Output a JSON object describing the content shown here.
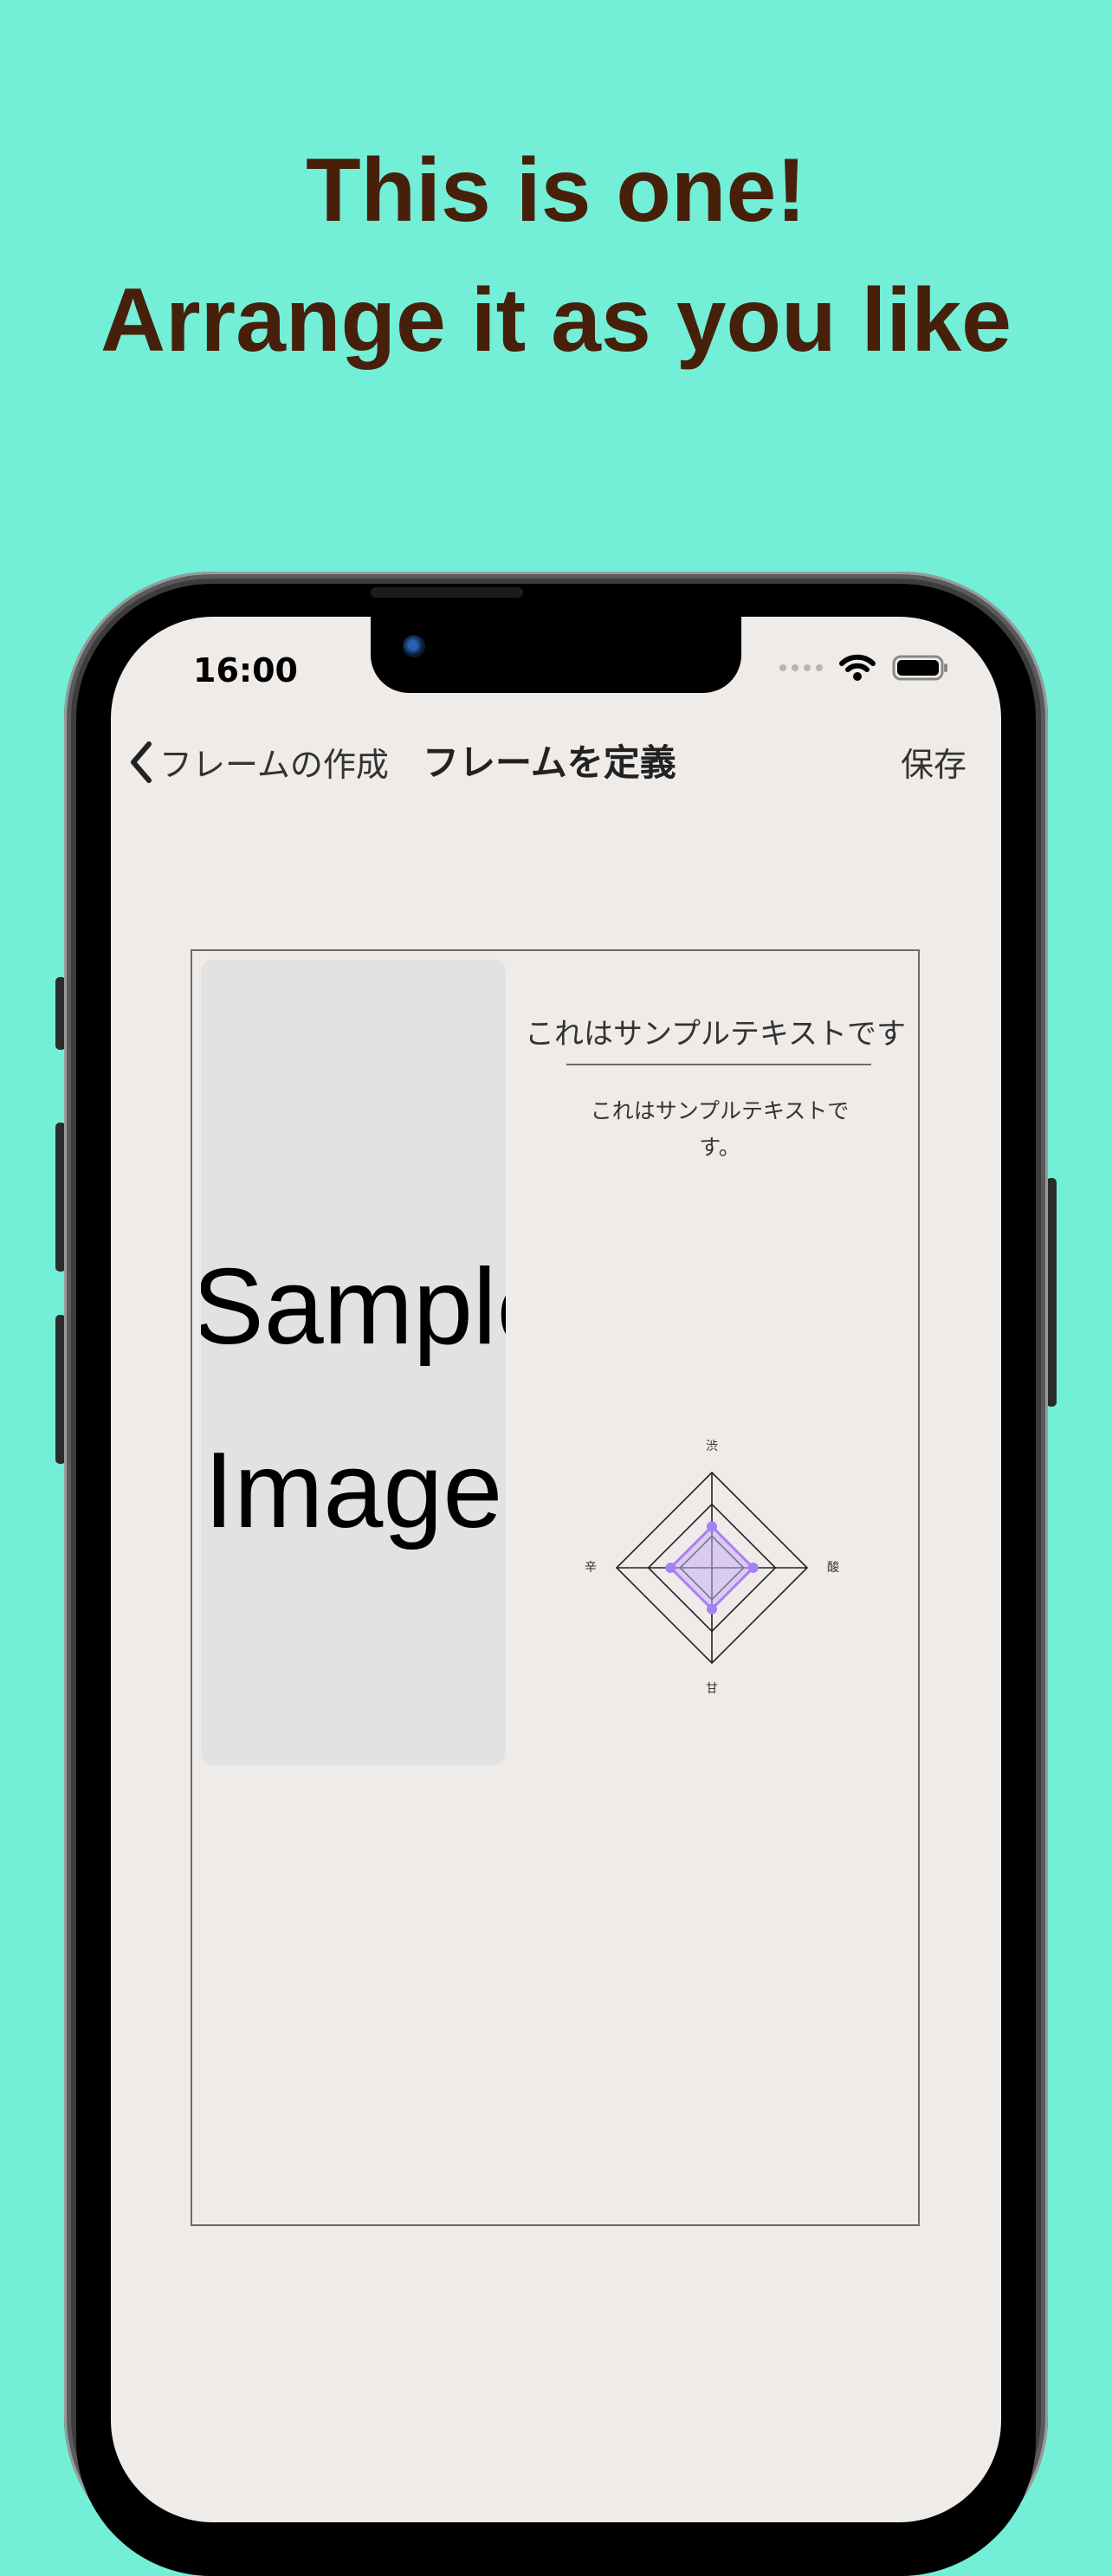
{
  "promo": {
    "line1": "This is one!",
    "line2": "Arrange it as you like"
  },
  "status_bar": {
    "time": "16:00",
    "icons": [
      "cellular-dots-icon",
      "wifi-icon",
      "battery-icon"
    ]
  },
  "nav": {
    "back_label": "フレームの作成",
    "title": "フレームを定義",
    "save_label": "保存"
  },
  "frame": {
    "image_placeholder": {
      "line1": "Sample",
      "line2": "Image"
    },
    "title": "これはサンプルテキストです",
    "body": "これはサンプルテキストです。"
  },
  "chart_data": {
    "type": "radar",
    "axes": [
      "渋",
      "酸",
      "甘",
      "辛"
    ],
    "levels": 3,
    "range": [
      0,
      3
    ],
    "series": [
      {
        "values": [
          1.3,
          1.3,
          1.3,
          1.3
        ]
      }
    ]
  },
  "colors": {
    "background": "#72efd6",
    "headline": "#47200c",
    "screen": "#efebe8",
    "radar_fill": "#c9b3f2",
    "radar_point": "#a77ff2"
  }
}
